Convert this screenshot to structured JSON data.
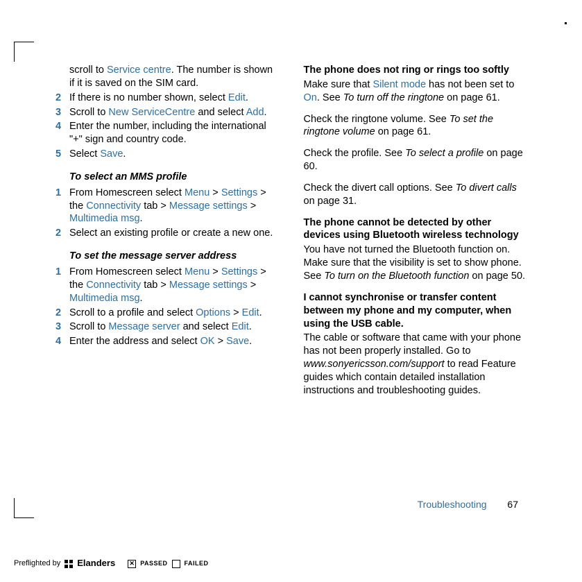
{
  "left": {
    "steps1": [
      {
        "n": "",
        "body_html": "scroll to <span class='link'>Service centre</span>. The number is shown if it is saved on the SIM card."
      },
      {
        "n": "2",
        "body_html": "If there is no number shown, select <span class='link'>Edit</span>."
      },
      {
        "n": "3",
        "body_html": "Scroll to <span class='link'>New ServiceCentre</span> and select <span class='link'>Add</span>."
      },
      {
        "n": "4",
        "body_html": "Enter the number, including the international \"+\" sign and country code."
      },
      {
        "n": "5",
        "body_html": "Select <span class='link'>Save</span>."
      }
    ],
    "sec2_head": "To select an MMS profile",
    "steps2": [
      {
        "n": "1",
        "body_html": "From Homescreen select <span class='link'>Menu</span> > <span class='link'>Settings</span> > the <span class='link'>Connectivity</span> tab > <span class='link'>Message settings</span> > <span class='link'>Multimedia msg</span>."
      },
      {
        "n": "2",
        "body_html": "Select an existing profile or create a new one."
      }
    ],
    "sec3_head": "To set the message server address",
    "steps3": [
      {
        "n": "1",
        "body_html": "From Homescreen select <span class='link'>Menu</span> > <span class='link'>Settings</span> > the <span class='link'>Connectivity</span> tab > <span class='link'>Message settings</span> > <span class='link'>Multimedia msg</span>."
      },
      {
        "n": "2",
        "body_html": "Scroll to a profile and select <span class='link'>Options</span> > <span class='link'>Edit</span>."
      },
      {
        "n": "3",
        "body_html": "Scroll to <span class='link'>Message server</span> and select <span class='link'>Edit</span>."
      },
      {
        "n": "4",
        "body_html": "Enter the address and select <span class='link'>OK</span> > <span class='link'>Save</span>."
      }
    ]
  },
  "right": {
    "b1_head": "The phone does not ring or rings too softly",
    "b1_p1_html": "Make sure that <span class='link'>Silent mode</span> has not been set to <span class='link'>On</span>. See <span class='ital'>To turn off the ringtone</span> on page 61.",
    "b1_p2_html": "Check the ringtone volume. See <span class='ital'>To set the ringtone volume</span> on page 61.",
    "b1_p3_html": "Check the profile. See <span class='ital'>To select a profile</span> on page 60.",
    "b1_p4_html": "Check the divert call options. See <span class='ital'>To divert calls</span> on page 31.",
    "b2_head": "The phone cannot be detected by other devices using Bluetooth wireless technology",
    "b2_p1_html": "You have not turned the Bluetooth function on. Make sure that the visibility is set to show phone. See <span class='ital'>To turn on the Bluetooth function</span> on page 50.",
    "b3_head": "I cannot synchronise or transfer content between my phone and my computer, when using the USB cable.",
    "b3_p1_html": "The cable or software that came with your phone has not been properly installed. Go to <span class='ital'>www.sonyericsson.com/support</span> to read Feature guides which contain detailed installation instructions and troubleshooting guides."
  },
  "footer": {
    "section": "Troubleshooting",
    "page": "67"
  },
  "preflight": {
    "by": "Preflighted by",
    "brand": "Elanders",
    "passed": "PASSED",
    "failed": "FAILED"
  }
}
